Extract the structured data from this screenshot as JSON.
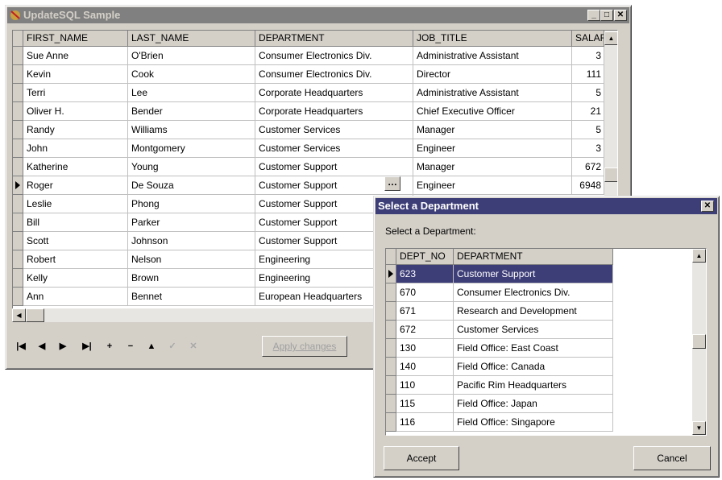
{
  "main_window": {
    "title": "UpdateSQL Sample",
    "columns": [
      "FIRST_NAME",
      "LAST_NAME",
      "DEPARTMENT",
      "JOB_TITLE",
      "SALAF"
    ],
    "rows": [
      [
        "Sue Anne",
        "O'Brien",
        "Consumer Electronics Div.",
        "Administrative Assistant",
        "3"
      ],
      [
        "Kevin",
        "Cook",
        "Consumer Electronics Div.",
        "Director",
        "111"
      ],
      [
        "Terri",
        "Lee",
        "Corporate Headquarters",
        "Administrative Assistant",
        "5"
      ],
      [
        "Oliver H.",
        "Bender",
        "Corporate Headquarters",
        "Chief Executive Officer",
        "21"
      ],
      [
        "Randy",
        "Williams",
        "Customer Services",
        "Manager",
        "5"
      ],
      [
        "John",
        "Montgomery",
        "Customer Services",
        "Engineer",
        "3"
      ],
      [
        "Katherine",
        "Young",
        "Customer Support",
        "Manager",
        "672"
      ],
      [
        "Roger",
        "De Souza",
        "Customer Support",
        "Engineer",
        "6948"
      ],
      [
        "Leslie",
        "Phong",
        "Customer Support",
        "",
        ""
      ],
      [
        "Bill",
        "Parker",
        "Customer Support",
        "",
        ""
      ],
      [
        "Scott",
        "Johnson",
        "Customer Support",
        "",
        ""
      ],
      [
        "Robert",
        "Nelson",
        "Engineering",
        "",
        ""
      ],
      [
        "Kelly",
        "Brown",
        "Engineering",
        "",
        ""
      ],
      [
        "Ann",
        "Bennet",
        "European Headquarters",
        "",
        ""
      ]
    ],
    "current_row": 7,
    "apply_label": "Apply changes",
    "nav_icons": [
      "first-icon",
      "prior-icon",
      "next-icon",
      "last-icon",
      "insert-icon",
      "delete-icon",
      "edit-icon",
      "post-icon",
      "cancel-icon"
    ],
    "nav_glyphs": [
      "|◀",
      "◀",
      "▶",
      "▶|",
      "+",
      "−",
      "▲",
      "✓",
      "✕"
    ]
  },
  "dialog": {
    "title": "Select a Department",
    "prompt": "Select a Department:",
    "columns": [
      "DEPT_NO",
      "DEPARTMENT"
    ],
    "rows": [
      [
        "623",
        "Customer Support"
      ],
      [
        "670",
        "Consumer Electronics Div."
      ],
      [
        "671",
        "Research and Development"
      ],
      [
        "672",
        "Customer Services"
      ],
      [
        "130",
        "Field Office: East Coast"
      ],
      [
        "140",
        "Field Office: Canada"
      ],
      [
        "110",
        "Pacific Rim Headquarters"
      ],
      [
        "115",
        "Field Office: Japan"
      ],
      [
        "116",
        "Field Office: Singapore"
      ]
    ],
    "selected_row": 0,
    "accept_label": "Accept",
    "cancel_label": "Cancel"
  },
  "colors": {
    "selection": "#3d3d78",
    "face": "#d4d0c8"
  }
}
